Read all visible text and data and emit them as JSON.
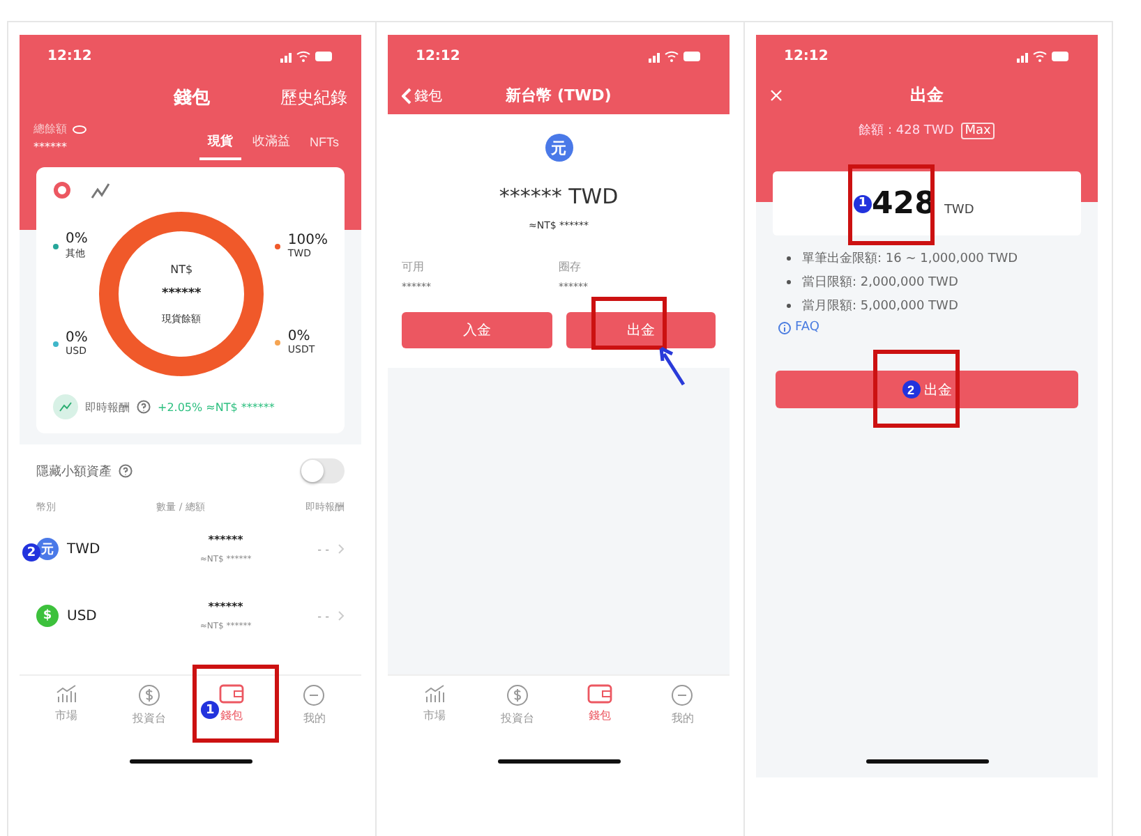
{
  "panels": [
    {
      "kind": "wallet",
      "time": "12:12",
      "title": "錢包",
      "history": "歷史紀錄",
      "balance_label": "總餘額",
      "balance_value": "******",
      "tabs": [
        {
          "label": "現貨",
          "selected": true
        },
        {
          "label": "收滿益",
          "selected": false
        },
        {
          "label": "NFTs",
          "selected": false
        }
      ],
      "legend": [
        {
          "percent": "0%",
          "name": "其他",
          "color": "#26a69a"
        },
        {
          "percent": "100%",
          "name": "TWD",
          "color": "#f0592a"
        },
        {
          "percent": "0%",
          "name": "USD",
          "color": "#3fb6c9"
        },
        {
          "percent": "0%",
          "name": "USDT",
          "color": "#f5a452"
        }
      ],
      "donut": {
        "currency": "NT$",
        "amount": "******",
        "caption": "現貨餘額"
      },
      "reward": {
        "label": "即時報酬",
        "value": "+2.05% ≈NT$ ******"
      },
      "hide_small": {
        "label": "隱藏小額資產",
        "on": false
      },
      "columns": [
        "幣別",
        "數量 / 總額",
        "即時報酬"
      ],
      "assets": [
        {
          "kind": "twd",
          "glyph": "元",
          "symbol": "TWD",
          "amount": "******",
          "approx": "≈NT$ ******",
          "reward": "- -",
          "marker": "2"
        },
        {
          "kind": "usd",
          "glyph": "$",
          "symbol": "USD",
          "amount": "******",
          "approx": "≈NT$ ******",
          "reward": "- -"
        }
      ],
      "nav": [
        {
          "kind": "market",
          "label": "市場",
          "selected": false
        },
        {
          "kind": "invest",
          "label": "投資台",
          "selected": false
        },
        {
          "kind": "wallet",
          "label": "錢包",
          "selected": true,
          "marker": "1",
          "highlighted": true
        },
        {
          "kind": "me",
          "label": "我的",
          "selected": false
        }
      ]
    },
    {
      "kind": "currency",
      "time": "12:12",
      "back": "錢包",
      "title": "新台幣 (TWD)",
      "glyph": "元",
      "amount": "****** TWD",
      "approx": "≈NT$ ******",
      "stats": [
        {
          "label": "可用",
          "value": "******"
        },
        {
          "label": "圈存",
          "value": "******"
        }
      ],
      "buttons": [
        {
          "label": "入金",
          "highlighted": false,
          "pointer": false
        },
        {
          "label": "出金",
          "highlighted": true,
          "pointer": true
        }
      ],
      "nav": [
        {
          "kind": "market",
          "label": "市場",
          "selected": false
        },
        {
          "kind": "invest",
          "label": "投資台",
          "selected": false
        },
        {
          "kind": "wallet",
          "label": "錢包",
          "selected": true
        },
        {
          "kind": "me",
          "label": "我的",
          "selected": false
        }
      ]
    },
    {
      "kind": "withdraw",
      "time": "12:12",
      "title": "出金",
      "balance": "餘額 : 428 TWD",
      "max": "Max",
      "input": {
        "value": "428",
        "unit": "TWD",
        "marker": "1",
        "highlighted": true
      },
      "limits": [
        "單筆出金限額: 16 ~ 1,000,000 TWD",
        "當日限額: 2,000,000 TWD",
        "當月限額: 5,000,000 TWD"
      ],
      "faq": "FAQ",
      "submit": {
        "label": "出金",
        "marker": "2",
        "highlighted": true
      }
    }
  ]
}
